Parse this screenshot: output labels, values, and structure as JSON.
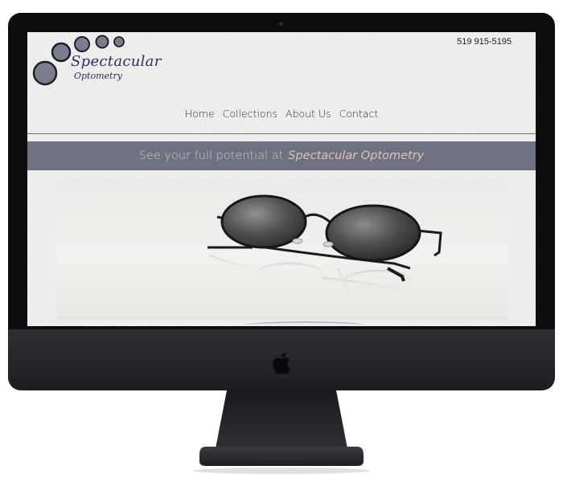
{
  "site": {
    "logo_top": "Spectacular",
    "logo_bottom": "Optometry",
    "phone": "519 915-5195"
  },
  "nav": {
    "items": [
      {
        "label": "Home"
      },
      {
        "label": "Collections"
      },
      {
        "label": "About Us"
      },
      {
        "label": "Contact"
      }
    ]
  },
  "banner": {
    "text": "See your full potential at",
    "emphasis": "Spectacular Optometry"
  },
  "colors": {
    "banner_bg": "#6d7182",
    "banner_text": "#e3c0b6",
    "logo_text": "#2c2f5c",
    "circle_fill": "#7a7d8d"
  },
  "icons": {
    "brand": "apple-logo-icon"
  }
}
